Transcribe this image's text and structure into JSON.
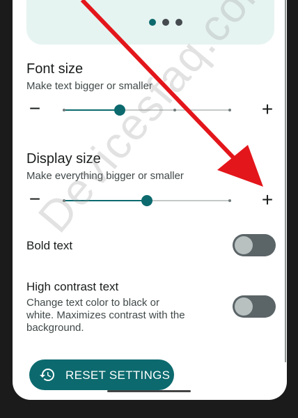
{
  "settings": {
    "font_size": {
      "title": "Font size",
      "subtitle": "Make text bigger or smaller",
      "minus": "−",
      "plus": "+",
      "value_step": 2,
      "step_count": 4
    },
    "display_size": {
      "title": "Display size",
      "subtitle": "Make everything bigger or smaller",
      "minus": "−",
      "plus": "+",
      "value_step": 2,
      "step_count": 3
    },
    "bold_text": {
      "title": "Bold text",
      "enabled": false
    },
    "high_contrast_text": {
      "title": "High contrast text",
      "subtitle_line1": "Change text color to black or",
      "subtitle_line2": "white. Maximizes contrast with the",
      "subtitle_line3": "background.",
      "enabled": false
    }
  },
  "preview": {
    "page_count": 3,
    "active_page": 1
  },
  "reset_button": {
    "label": "RESET SETTINGS",
    "icon": "history-reset-icon"
  },
  "watermark": "Devicesfaq.com",
  "colors": {
    "accent": "#0c6a6e",
    "annotation_arrow": "#e3161b"
  }
}
